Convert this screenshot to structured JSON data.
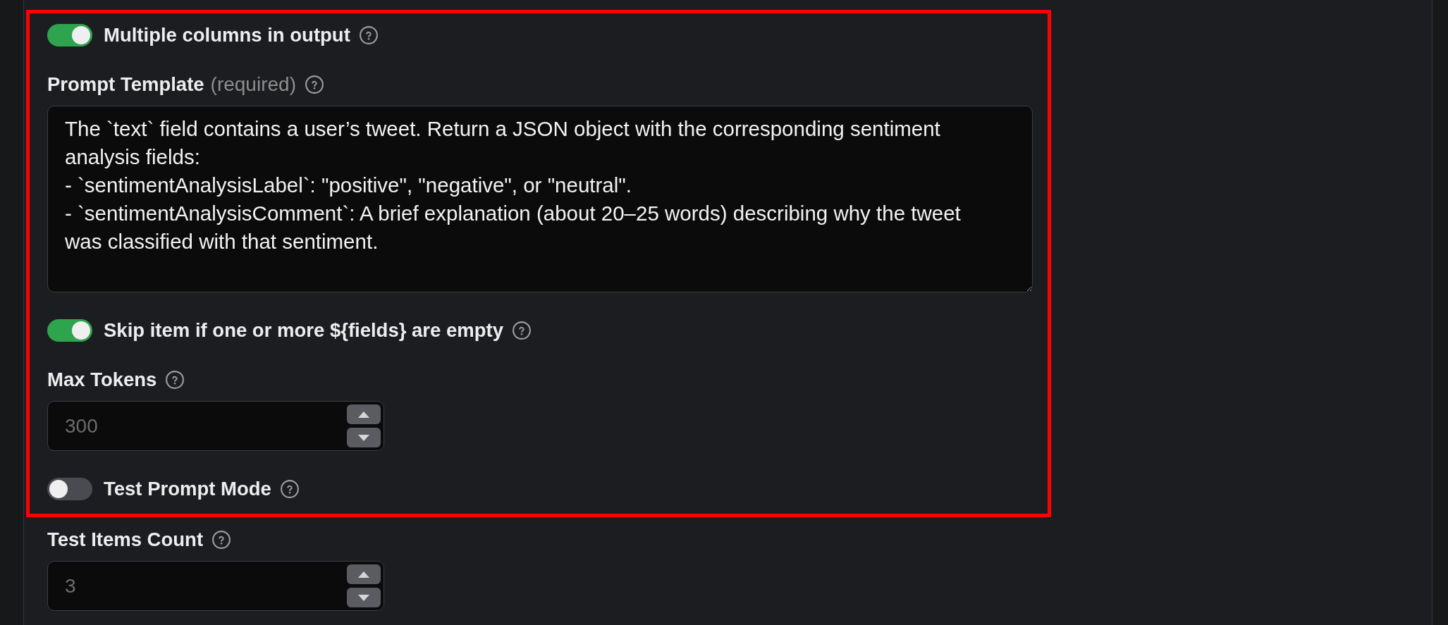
{
  "highlighted_section": {
    "fields": [
      {
        "kind": "toggle",
        "label": "Multiple columns in output",
        "on": true
      },
      {
        "kind": "textarea",
        "label": "Prompt Template",
        "hint": "(required)",
        "value": "The `text` field contains a user’s tweet. Return a JSON object with the corresponding sentiment analysis fields:\n- `sentimentAnalysisLabel`: \"positive\", \"negative\", or \"neutral\".\n- `sentimentAnalysisComment`: A brief explanation (about 20–25 words) describing why the tweet was classified with that sentiment."
      },
      {
        "kind": "toggle",
        "label": "Skip item if one or more ${fields} are empty",
        "on": true
      },
      {
        "kind": "number",
        "label": "Max Tokens",
        "placeholder": "300"
      },
      {
        "kind": "toggle",
        "label": "Test Prompt Mode",
        "on": false
      }
    ]
  },
  "fields": [
    {
      "kind": "number",
      "label": "Test Items Count",
      "placeholder": "3"
    }
  ]
}
